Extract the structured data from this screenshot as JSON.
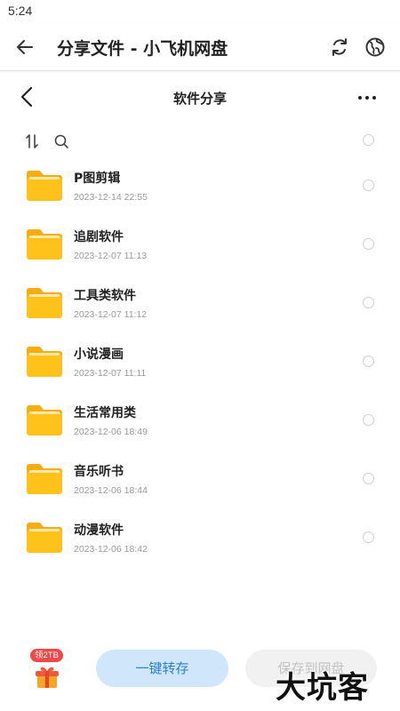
{
  "status_bar": {
    "time": "5:24"
  },
  "app_bar": {
    "title": "分享文件 - 小飞机网盘",
    "icons": {
      "back": "arrow-back-icon",
      "refresh": "refresh-icon",
      "globe": "globe-icon"
    }
  },
  "sub_bar": {
    "title": "软件分享",
    "icons": {
      "back": "chevron-left-icon",
      "more": "more-horizontal-icon"
    }
  },
  "toolbar": {
    "icons": {
      "sort": "sort-icon",
      "search": "search-icon"
    }
  },
  "files": [
    {
      "name": "P图剪辑",
      "date": "2023-12-14 22:55"
    },
    {
      "name": "追剧软件",
      "date": "2023-12-07 11:13"
    },
    {
      "name": "工具类软件",
      "date": "2023-12-07 11:12"
    },
    {
      "name": "小说漫画",
      "date": "2023-12-07 11:11"
    },
    {
      "name": "生活常用类",
      "date": "2023-12-06 18:49"
    },
    {
      "name": "音乐听书",
      "date": "2023-12-06 18:44"
    },
    {
      "name": "动漫软件",
      "date": "2023-12-06 18:42"
    }
  ],
  "bottom": {
    "gift_badge": "领2TB",
    "transfer_label": "一键转存",
    "save_label": "保存到网盘",
    "watermark": "大坑客"
  },
  "colors": {
    "folder": "#ffc21a",
    "folder_tab": "#f6ad0f",
    "transfer_bg": "#cfe6fb",
    "transfer_text": "#2a7fd9",
    "badge": "#f04747"
  }
}
